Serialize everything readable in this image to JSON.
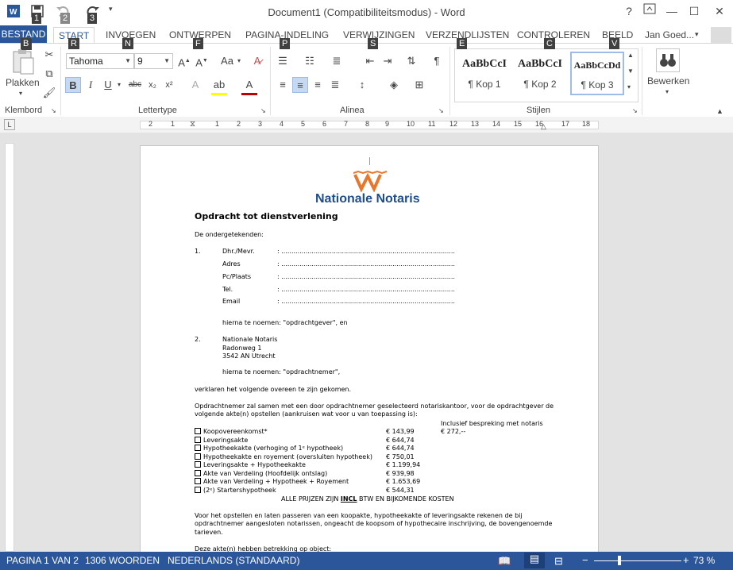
{
  "window": {
    "title": "Document1 (Compatibiliteitsmodus) - Word",
    "help": "?",
    "minimize": "—",
    "maximize": "☐",
    "close": "✕"
  },
  "qat": {
    "keytips": [
      "1",
      "2",
      "3"
    ]
  },
  "tabs": {
    "file": "BESTAND",
    "items": [
      "START",
      "INVOEGEN",
      "ONTWERPEN",
      "PAGINA-INDELING",
      "VERWIJZINGEN",
      "VERZENDLIJSTEN",
      "CONTROLEREN",
      "BEELD"
    ],
    "keytips": [
      "R",
      "N",
      "F",
      "P",
      "S",
      "E",
      "C",
      "V"
    ],
    "file_keytip": "B",
    "user": "Jan Goed..."
  },
  "ribbon": {
    "clipboard": {
      "paste": "Plakken",
      "label": "Klembord"
    },
    "font": {
      "name": "Tahoma",
      "size": "9",
      "label": "Lettertype",
      "aa": "Aa"
    },
    "paragraph": {
      "label": "Alinea"
    },
    "styles": {
      "label": "Stijlen",
      "items": [
        {
          "sample": "AaBbCcI",
          "name": "¶ Kop 1"
        },
        {
          "sample": "AaBbCcI",
          "name": "¶ Kop 2"
        },
        {
          "sample": "AaBbCcDd",
          "name": "¶ Kop 3"
        }
      ]
    },
    "editing": {
      "label": "Bewerken"
    }
  },
  "ruler": {
    "numbers": [
      "2",
      "1",
      "1",
      "2",
      "3",
      "4",
      "5",
      "6",
      "7",
      "8",
      "9",
      "10",
      "11",
      "12",
      "13",
      "14",
      "15",
      "16",
      "17",
      "18"
    ]
  },
  "doc": {
    "logo_text": "Nationale Notaris",
    "heading": "Opdracht tot dienstverlening",
    "intro": "De ondergetekenden:",
    "party1_num": "1.",
    "fields": [
      {
        "label": "Dhr./Mevr.",
        "value": ": ......................................................................................"
      },
      {
        "label": "Adres",
        "value": ": ......................................................................................"
      },
      {
        "label": "Pc/Plaats",
        "value": ": ......................................................................................"
      },
      {
        "label": "Tel.",
        "value": ": ......................................................................................"
      },
      {
        "label": "Email",
        "value": ": ......................................................................................"
      }
    ],
    "party1_name": "hierna te noemen: \"opdrachtgever\", en",
    "party2_num": "2.",
    "party2_lines": [
      "Nationale Notaris",
      "Radonweg 1",
      "3542 AN Utrecht"
    ],
    "party2_name": "hierna te noemen: \"opdrachtnemer\",",
    "declared": "verklaren het volgende overeen te zijn gekomen.",
    "para1": [
      "Opdrachtnemer zal samen met een door opdrachtnemer geselecteerd notariskantoor, voor de opdrachtgever de",
      "volgende akte(n) opstellen (aankruisen wat voor u van toepassing is):"
    ],
    "incl_header": "Inclusief bespreking met notaris",
    "incl_price": "€   272,--",
    "items": [
      {
        "label": "Koopovereenkomst*",
        "price": "€   143,99"
      },
      {
        "label": "Leveringsakte",
        "price": "€   644,74"
      },
      {
        "label": "Hypotheekakte (verhoging of 1ᵉ hypotheek)",
        "price": "€   644,74"
      },
      {
        "label": "Hypotheekakte en royement (oversluiten hypotheek)",
        "price": "€   750,01"
      },
      {
        "label": "Leveringsakte + Hypotheekakte",
        "price": "€ 1.199,94"
      },
      {
        "label": "Akte van Verdeling (Hoofdelijk ontslag)",
        "price": "€   939,98"
      },
      {
        "label": "Akte van Verdeling + Hypotheek + Royement",
        "price": "€ 1.653,69"
      },
      {
        "label": "(2ᵉ) Starters­hypotheek",
        "price": "€   544,31"
      }
    ],
    "prices_note_pre": "ALLE PRIJZEN ZIJN ",
    "prices_note_incl": "INCL",
    "prices_note_post": " BTW EN BIJKOMENDE KOSTEN",
    "para2": [
      "Voor het opstellen en laten passeren van een koopakte, hypotheekakte of leveringsakte rekenen de bij",
      "opdrachtnemer aangesloten notarissen, ongeacht de koopsom of hypothecaire inschrijving, de bovengenoemde",
      "tarieven."
    ],
    "para3": "Deze akte(n) hebben betrekking op object:"
  },
  "status": {
    "page": "PAGINA 1 VAN 2",
    "words": "1306 WOORDEN",
    "language": "NEDERLANDS (STANDAARD)",
    "zoom": "73 %"
  },
  "colors": {
    "accent": "#2b579a",
    "logo_orange": "#e8772e",
    "logo_blue": "#1f4e8c"
  }
}
